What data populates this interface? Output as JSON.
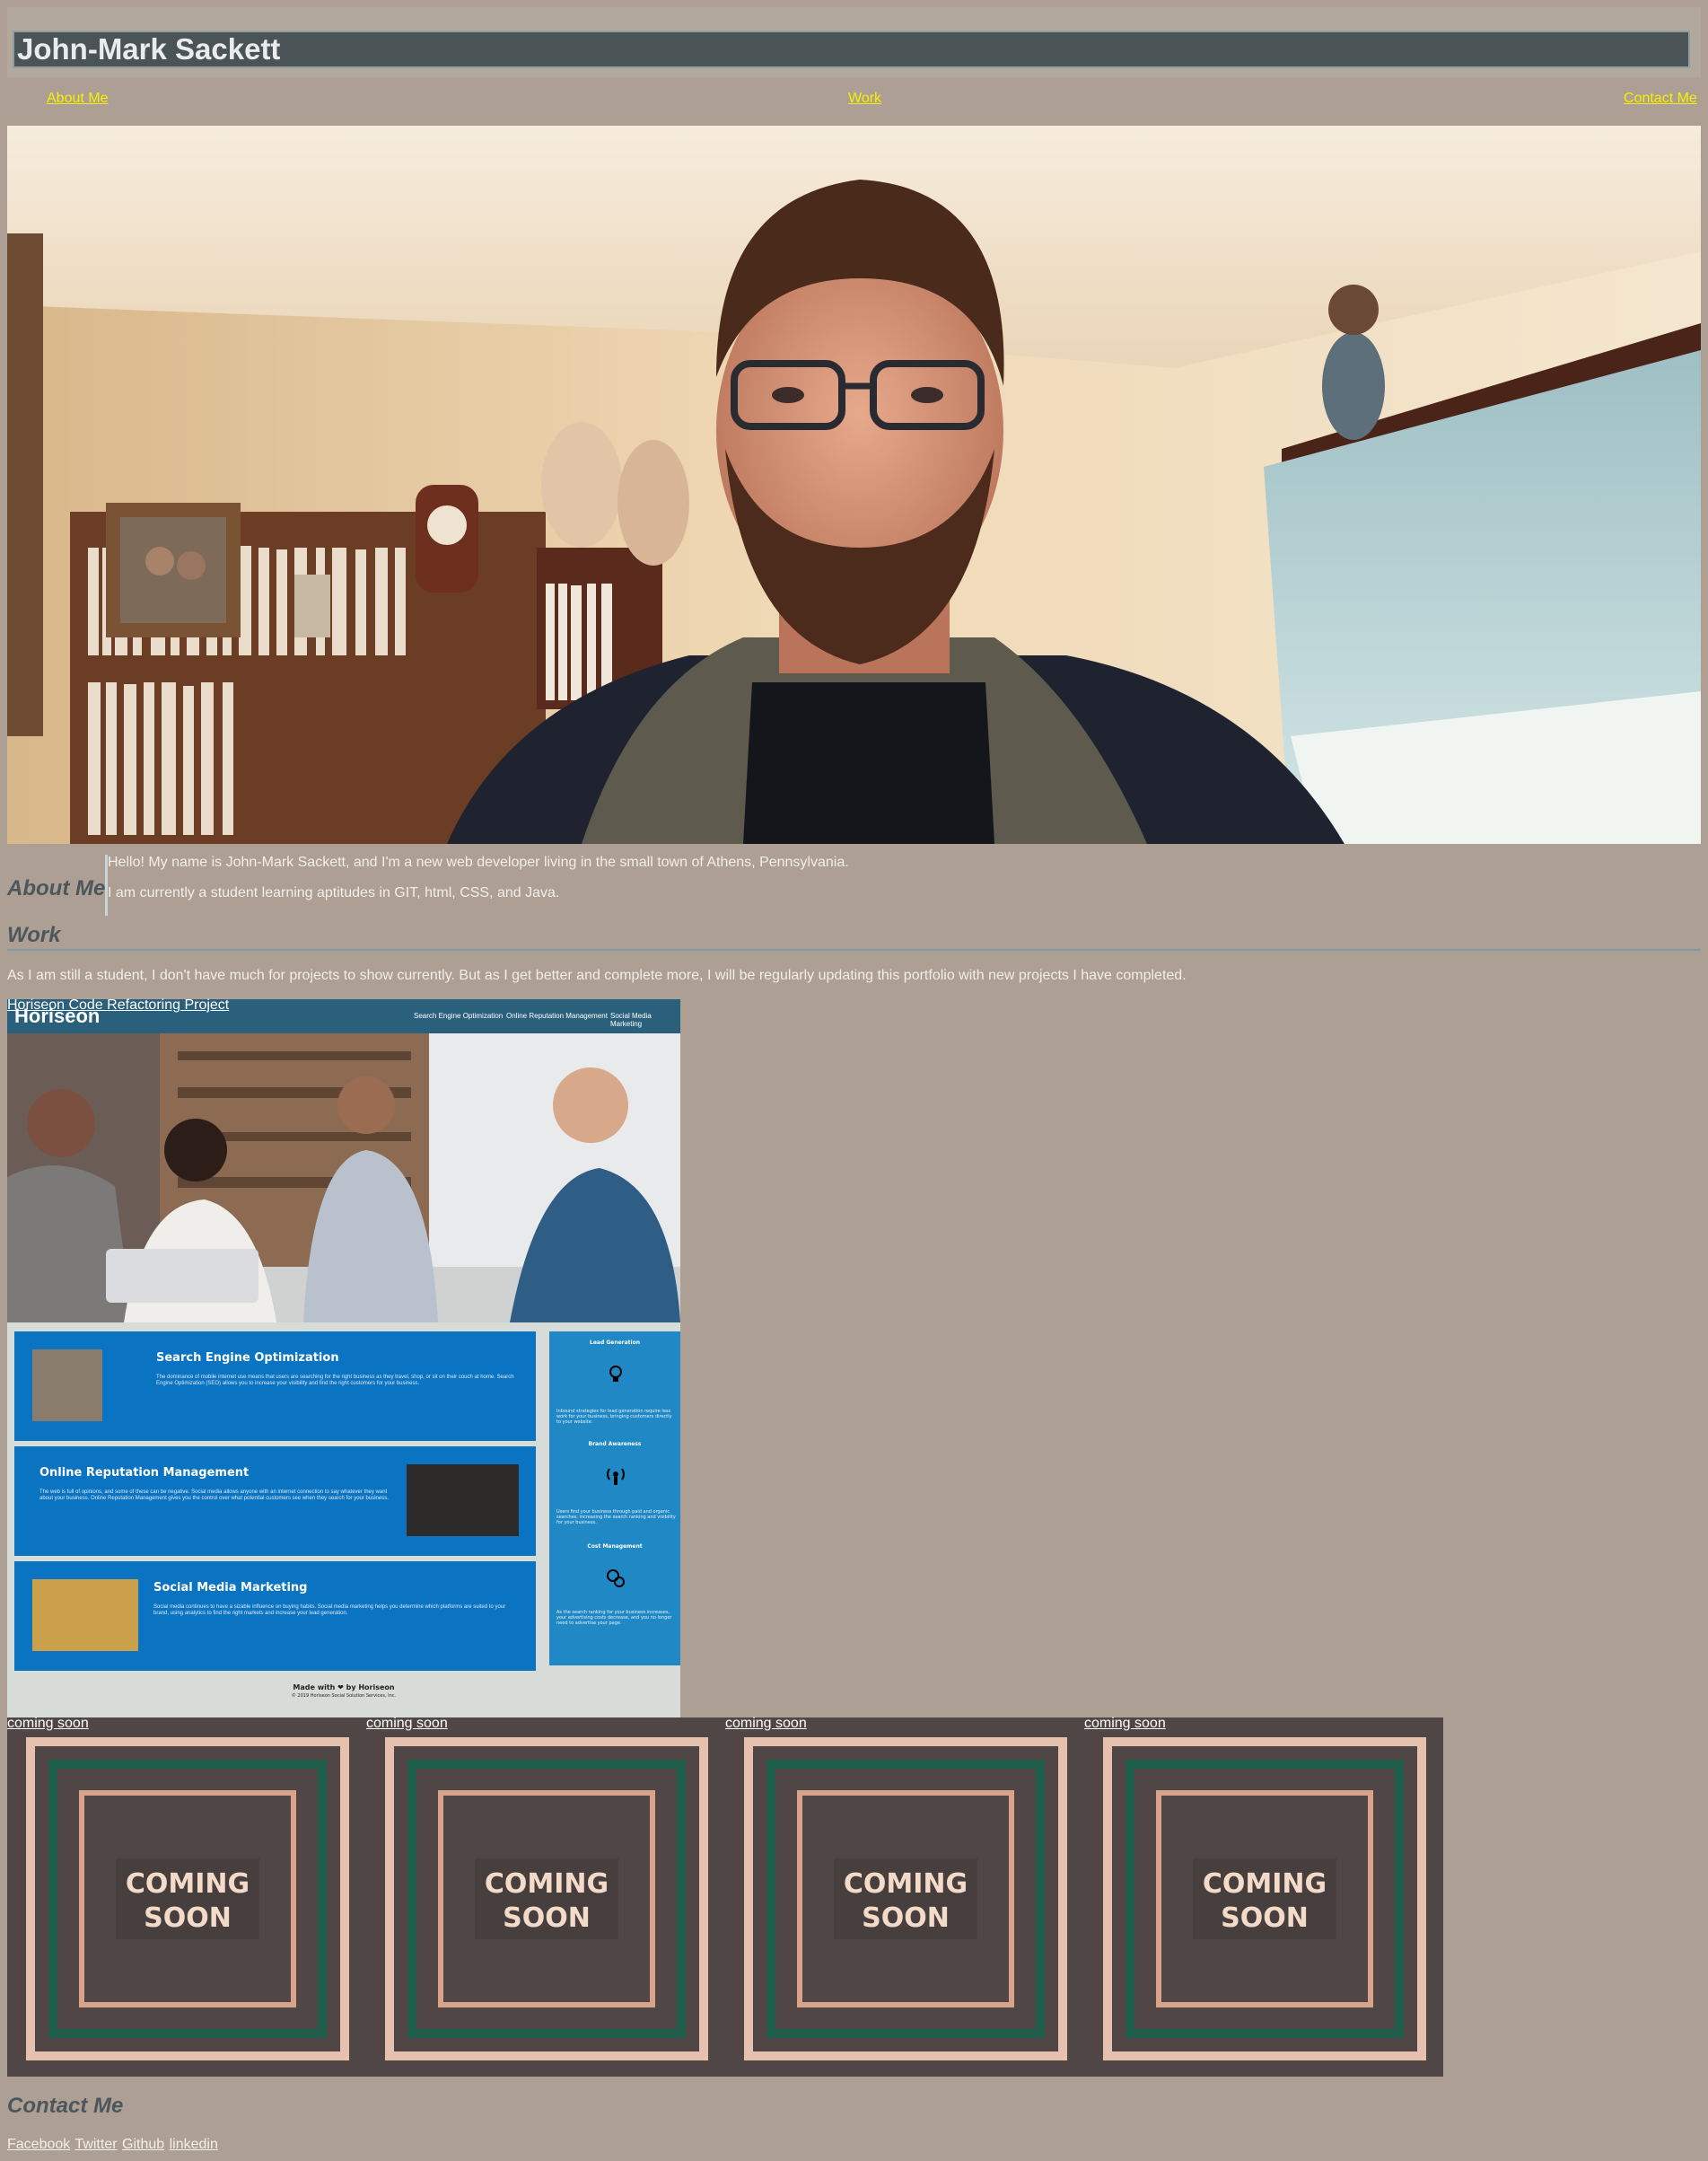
{
  "header": {
    "title": "John-Mark Sackett",
    "nav": [
      "About Me",
      "Work",
      "Contact Me"
    ]
  },
  "hero": {
    "alt": "portrait photo"
  },
  "about": {
    "heading": "About Me",
    "lines": [
      "Hello! My name is John-Mark Sackett, and I'm a new web developer living in the small town of Athens, Pennsylvania.",
      "I am currently a student learning aptitudes in GIT, html, CSS, and Java."
    ]
  },
  "work": {
    "heading": "Work",
    "intro": "As I am still a student, I don't have much for projects to show currently. But as I get better and complete more, I will be regularly updating this portfolio with new projects I have completed."
  },
  "project": {
    "link": "Horiseon Code Refactoring Project",
    "logo": "Horiseon",
    "nav": [
      "Search Engine Optimization",
      "Online Reputation Management",
      "Social Media Marketing"
    ],
    "cards": [
      {
        "title": "Search Engine Optimization",
        "text": "The dominance of mobile internet use means that users are searching for the right business as they travel, shop, or sit on their couch at home. Search Engine Optimization (SEO) allows you to increase your visibility and find the right customers for your business."
      },
      {
        "title": "Online Reputation Management",
        "text": "The web is full of opinions, and some of these can be negative. Social media allows anyone with an internet connection to say whatever they want about your business. Online Reputation Management gives you the control over what potential customers see when they search for your business."
      },
      {
        "title": "Social Media Marketing",
        "text": "Social media continues to have a sizable influence on buying habits. Social media marketing helps you determine which platforms are suited to your brand, using analytics to find the right markets and increase your lead generation."
      }
    ],
    "benefits": [
      {
        "title": "Lead Generation",
        "text": "Inbound strategies for lead generation require less work for your business, bringing customers directly to your website."
      },
      {
        "title": "Brand Awareness",
        "text": "Users find your business through paid and organic searches, increasing the search ranking and visibility for your business."
      },
      {
        "title": "Cost Management",
        "text": "As the search ranking for your business increases, your advertising costs decrease, and you no longer need to advertise your page."
      }
    ],
    "footer_made": "Made with ❤ by Horiseon",
    "footer_copy": "© 2019 Horiseon Social Solution Services, Inc."
  },
  "coming_soon": {
    "link": "coming soon",
    "badge_line1": "COMING",
    "badge_line2": "SOON"
  },
  "contact": {
    "heading": "Contact Me",
    "links": [
      "Facebook",
      "Twitter",
      "Github",
      "linkedin"
    ]
  },
  "colors": {
    "page_bg": "#ad9f93",
    "title_bar": "#4a5457",
    "nav_link": "#f7f000",
    "heading": "#4c575c",
    "project_blue": "#0b74c2",
    "coming_soon_bg": "#4f4645"
  }
}
